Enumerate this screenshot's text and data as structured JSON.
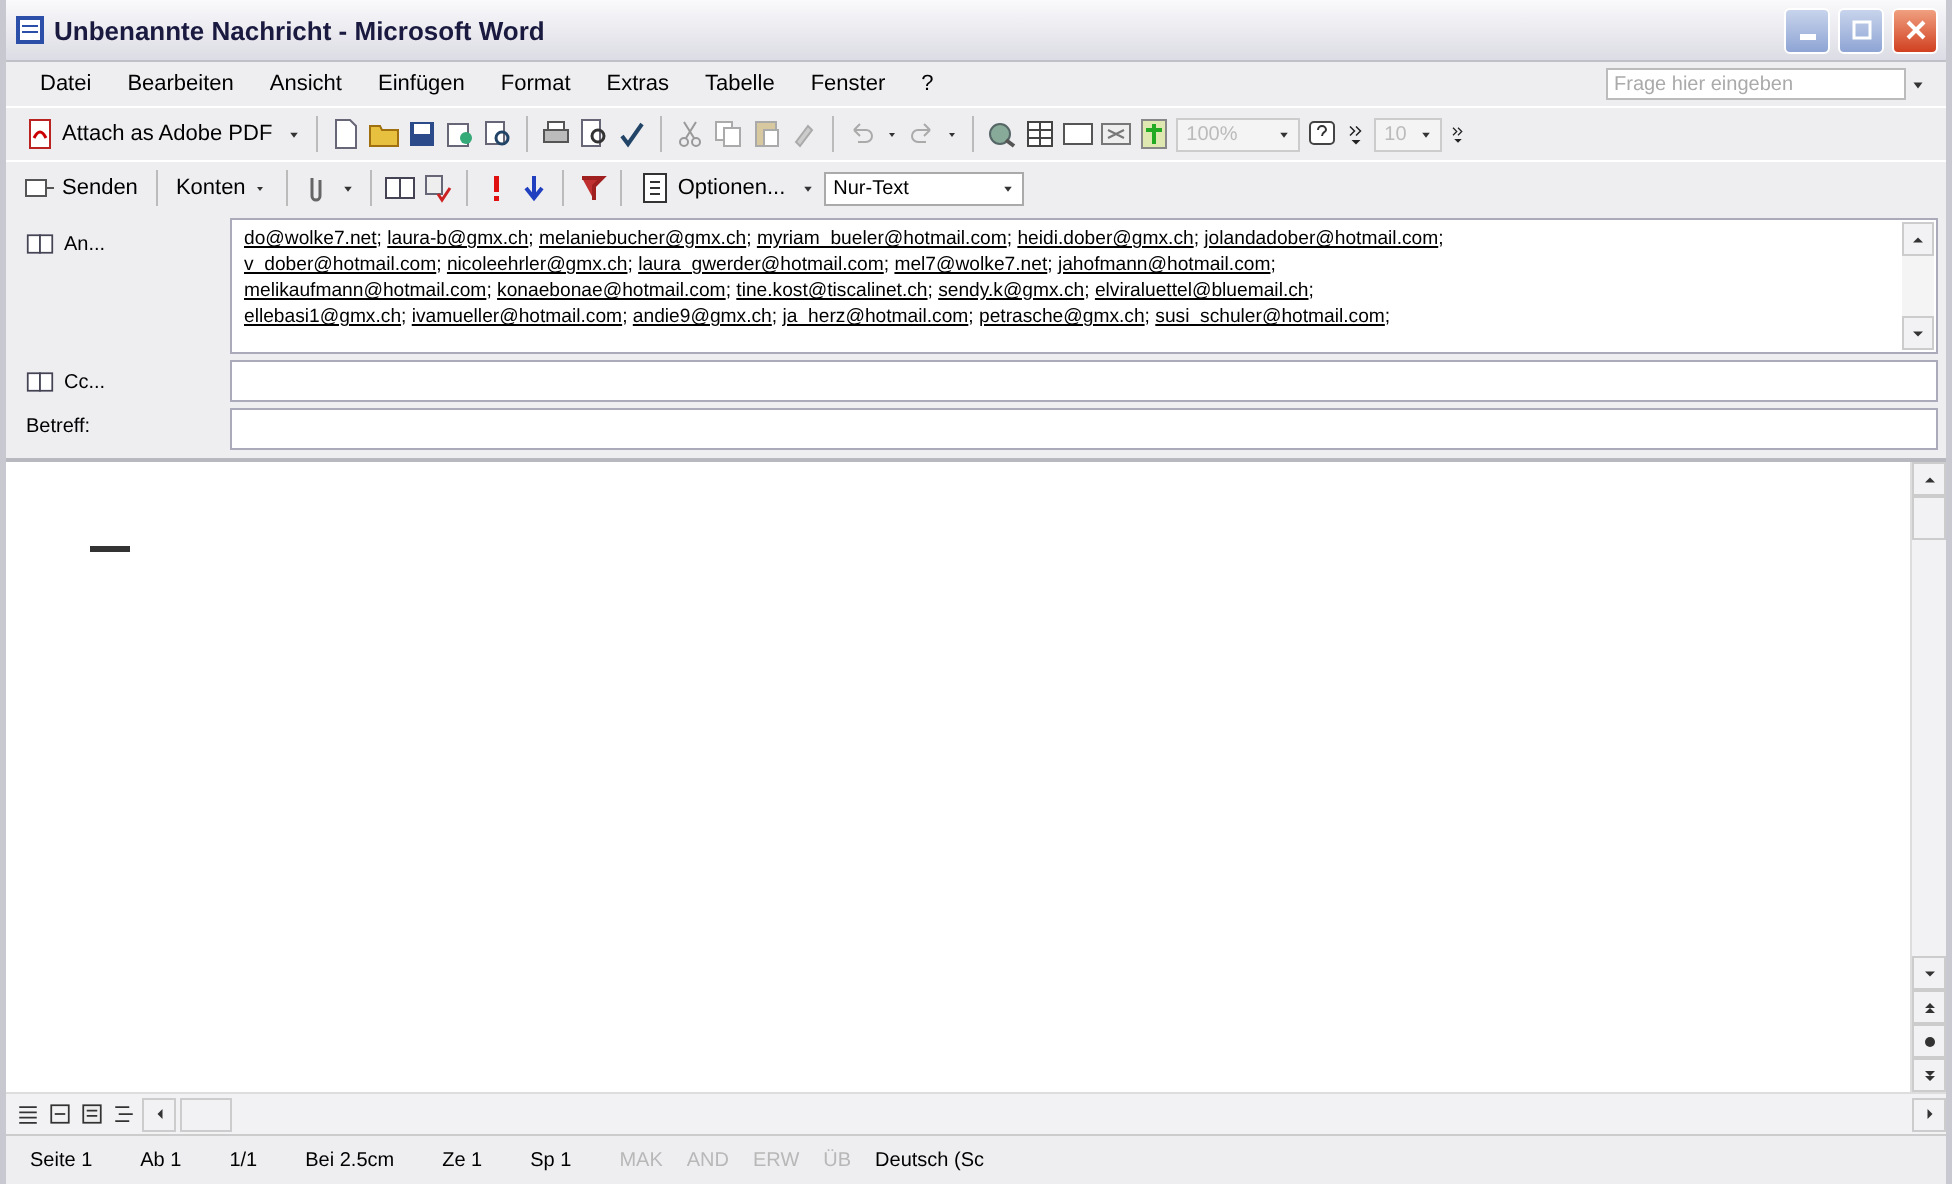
{
  "window": {
    "title": "Unbenannte Nachricht - Microsoft Word"
  },
  "menu": [
    {
      "label": "Datei"
    },
    {
      "label": "Bearbeiten"
    },
    {
      "label": "Ansicht"
    },
    {
      "label": "Einfügen"
    },
    {
      "label": "Format"
    },
    {
      "label": "Extras"
    },
    {
      "label": "Tabelle"
    },
    {
      "label": "Fenster"
    },
    {
      "label": "?"
    }
  ],
  "help_search": {
    "placeholder": "Frage hier eingeben"
  },
  "standard_toolbar": {
    "pdf_button": "Attach as Adobe PDF",
    "zoom": {
      "value": "100%",
      "disabled": true
    },
    "font_size": {
      "value": "10",
      "disabled": true
    }
  },
  "mail_toolbar": {
    "send": "Senden",
    "accounts": "Konten",
    "options": "Optionen...",
    "format": {
      "value": "Nur-Text"
    }
  },
  "to": {
    "label": "An...",
    "lines": [
      [
        {
          "address": "do@wolke7.net",
          "separator": ";"
        },
        {
          "address": "laura-b@gmx.ch",
          "separator": ";"
        },
        {
          "address": "melaniebucher@gmx.ch",
          "separator": ";"
        },
        {
          "address": "myriam_bueler@hotmail.com",
          "separator": ";"
        },
        {
          "address": "heidi.dober@gmx.ch",
          "separator": ";"
        },
        {
          "address": "jolandadober@hotmail.com",
          "separator": ";"
        }
      ],
      [
        {
          "address": "v_dober@hotmail.com",
          "separator": ";"
        },
        {
          "address": "nicoleehrler@gmx.ch",
          "separator": ";"
        },
        {
          "address": "laura_gwerder@hotmail.com",
          "separator": ";"
        },
        {
          "address": "mel7@wolke7.net",
          "separator": ";"
        },
        {
          "address": "jahofmann@hotmail.com",
          "separator": ";"
        }
      ],
      [
        {
          "address": "melikaufmann@hotmail.com",
          "separator": ";"
        },
        {
          "address": "konaebonae@hotmail.com",
          "separator": ";"
        },
        {
          "address": "tine.kost@tiscalinet.ch",
          "separator": ";"
        },
        {
          "address": "sendy.k@gmx.ch",
          "separator": ";"
        },
        {
          "address": "elviraluettel@bluemail.ch",
          "separator": ";"
        }
      ],
      [
        {
          "address": "ellebasi1@gmx.ch",
          "separator": ";"
        },
        {
          "address": "ivamueller@hotmail.com",
          "separator": ";"
        },
        {
          "address": "andie9@gmx.ch",
          "separator": ";"
        },
        {
          "address": "ja_herz@hotmail.com",
          "separator": ";"
        },
        {
          "address": "petrasche@gmx.ch",
          "separator": ";"
        },
        {
          "address": "susi_schuler@hotmail.com",
          "separator": ";"
        }
      ]
    ]
  },
  "cc": {
    "label": "Cc..."
  },
  "subject": {
    "label": "Betreff:"
  },
  "status_bar": [
    {
      "text": "Seite 1",
      "kind": "plain"
    },
    {
      "text": "Ab 1",
      "kind": "plain"
    },
    {
      "text": "1/1",
      "kind": "plain"
    },
    {
      "text": "Bei 2.5cm",
      "kind": "plain"
    },
    {
      "text": "Ze 1",
      "kind": "plain"
    },
    {
      "text": "Sp 1",
      "kind": "plain"
    },
    {
      "text": "MAK",
      "kind": "mode",
      "active": false
    },
    {
      "text": "AND",
      "kind": "mode",
      "active": false
    },
    {
      "text": "ERW",
      "kind": "mode",
      "active": false
    },
    {
      "text": "ÜB",
      "kind": "mode",
      "active": false
    },
    {
      "text": "Deutsch (Sc",
      "kind": "plain"
    }
  ]
}
